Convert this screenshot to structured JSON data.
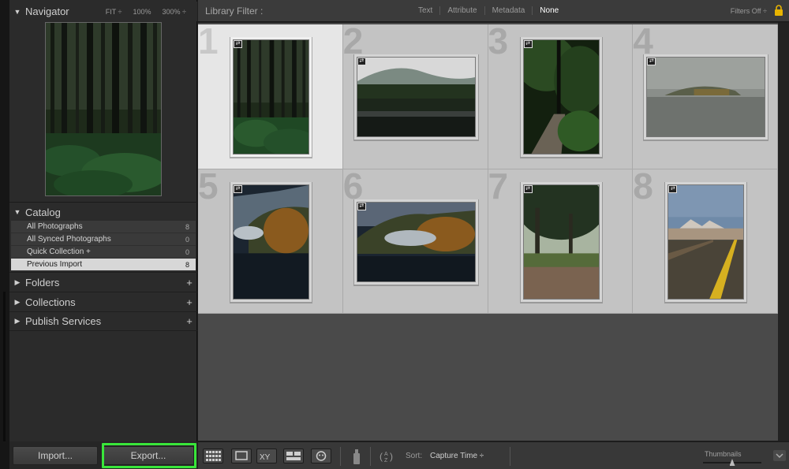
{
  "navigator": {
    "title": "Navigator",
    "zoom_options": [
      "FIT ÷",
      "100%",
      "300% ÷"
    ]
  },
  "catalog": {
    "title": "Catalog",
    "items": [
      {
        "label": "All Photographs",
        "count": "8"
      },
      {
        "label": "All Synced Photographs",
        "count": "0"
      },
      {
        "label": "Quick Collection  +",
        "count": "0"
      },
      {
        "label": "Previous Import",
        "count": "8"
      }
    ]
  },
  "panels": {
    "folders": "Folders",
    "collections": "Collections",
    "publish": "Publish Services"
  },
  "buttons": {
    "import": "Import...",
    "export": "Export..."
  },
  "filter_bar": {
    "title": "Library Filter :",
    "options": [
      "Text",
      "Attribute",
      "Metadata",
      "None"
    ],
    "active": "None",
    "filters_off": "Filters Off ÷"
  },
  "grid": {
    "cells": [
      {
        "num": "1",
        "orientation": "portrait",
        "selected": true,
        "scene": "forest"
      },
      {
        "num": "2",
        "orientation": "landscape",
        "selected": false,
        "scene": "lake-mist"
      },
      {
        "num": "3",
        "orientation": "portrait",
        "selected": false,
        "scene": "jungle-path"
      },
      {
        "num": "4",
        "orientation": "landscape",
        "selected": false,
        "scene": "fog-lake"
      },
      {
        "num": "5",
        "orientation": "portrait",
        "selected": false,
        "scene": "autumn-lake"
      },
      {
        "num": "6",
        "orientation": "landscape",
        "selected": false,
        "scene": "autumn-lake-wide"
      },
      {
        "num": "7",
        "orientation": "portrait",
        "selected": false,
        "scene": "tree-trail"
      },
      {
        "num": "8",
        "orientation": "portrait",
        "selected": false,
        "scene": "desert-road"
      }
    ]
  },
  "toolbar": {
    "sort_label": "Sort:",
    "sort_value": "Capture Time ÷",
    "thumbnails_label": "Thumbnails",
    "thumbnails_size": 0.5
  },
  "colors": {
    "highlight": "#39e63a",
    "selected_cell": "#e6e6e6",
    "cell": "#c3c3c3"
  }
}
